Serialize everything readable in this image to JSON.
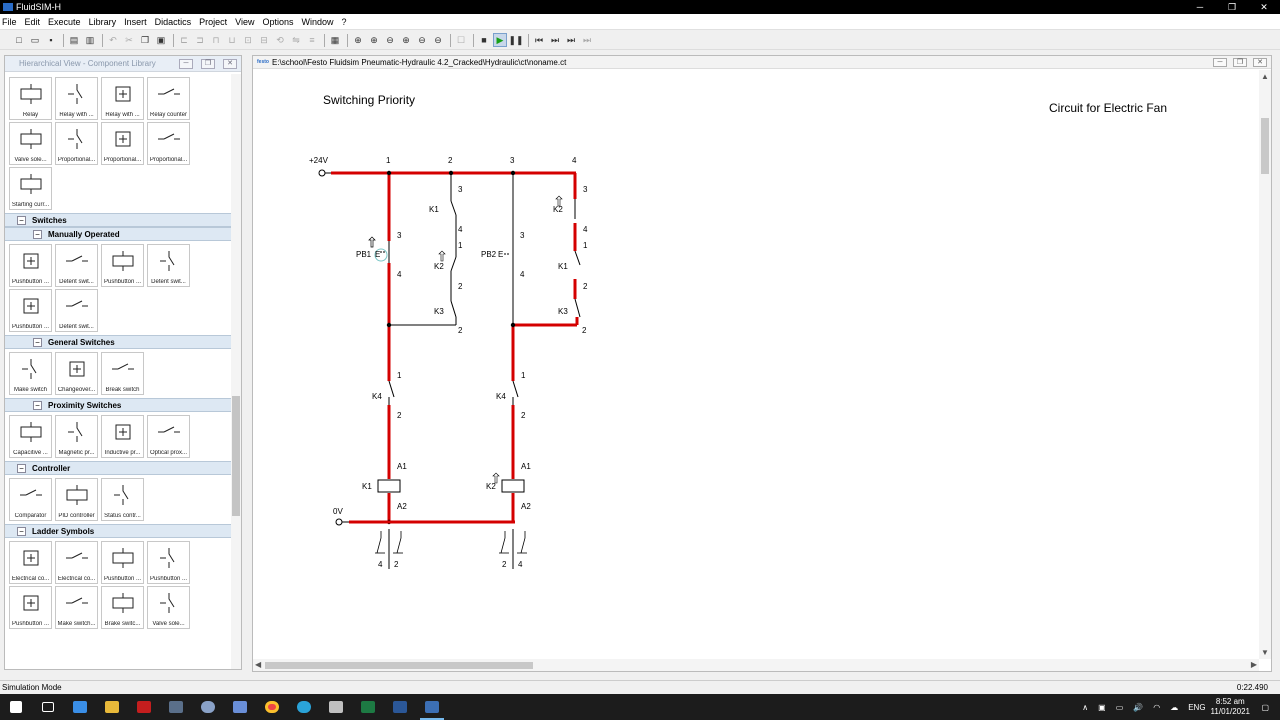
{
  "app": {
    "title": "FluidSIM-H",
    "window_controls": [
      "─",
      "❐",
      "✕"
    ]
  },
  "menu": [
    "File",
    "Edit",
    "Execute",
    "Library",
    "Insert",
    "Didactics",
    "Project",
    "View",
    "Options",
    "Window",
    "?"
  ],
  "left_panel": {
    "title": "Hierarchical View - Component Library",
    "groups": [
      {
        "header": "",
        "indent": 0,
        "tiles": [
          "Relay",
          "Relay with ...",
          "Relay with ...",
          "Relay counter",
          "Valve sole...",
          "Proportional...",
          "Proportional...",
          "Proportional...",
          "Starting curr..."
        ]
      },
      {
        "header": "Switches",
        "indent": 1,
        "tiles": []
      },
      {
        "header": "Manually Operated",
        "indent": 2,
        "tiles": [
          "Pushbutton ...",
          "Detent swit...",
          "Pushbutton ...",
          "Detent swit...",
          "Pushbutton ...",
          "Detent swit..."
        ]
      },
      {
        "header": "General Switches",
        "indent": 2,
        "tiles": [
          "Make switch",
          "Changeover...",
          "Break switch"
        ]
      },
      {
        "header": "Proximity Switches",
        "indent": 2,
        "tiles": [
          "Capacitive ...",
          "Magnetic pr...",
          "Inductive pr...",
          "Optical prox..."
        ]
      },
      {
        "header": "Controller",
        "indent": 1,
        "tiles": [
          "Comparator",
          "PID controller",
          "Status contr..."
        ]
      },
      {
        "header": "Ladder Symbols",
        "indent": 1,
        "tiles": [
          "Electrical co...",
          "Electrical co...",
          "Pushbutton ...",
          "Pushbutton ...",
          "Pushbutton ...",
          "Make switch...",
          "Brake switc...",
          "Valve sole..."
        ]
      }
    ]
  },
  "document": {
    "path": "E:\\school\\Festo Fluidsim Pneumatic-Hydraulic 4.2_Cracked\\Hydraulic\\ct\\noname.ct",
    "logo_text": "festo",
    "title_left": "Switching  Priority",
    "title_right": "Circuit for Electric Fan",
    "labels": {
      "v24": "+24V",
      "v0": "0V",
      "col1": "1",
      "col2": "2",
      "col3": "3",
      "col4": "4",
      "pb1": "PB1",
      "pb2": "PB2",
      "k1": "K1",
      "k2": "K2",
      "k3": "K3",
      "k4": "K4",
      "a1": "A1",
      "a2": "A2",
      "n1": "1",
      "n2": "2",
      "n3": "3",
      "n4": "4",
      "e": "E"
    }
  },
  "status": {
    "mode": "Simulation Mode",
    "time": "0:22.490"
  },
  "tray": {
    "lang": "ENG",
    "time": "8:52 am",
    "date": "11/01/2021"
  },
  "colors": {
    "wire_active": "#d40000",
    "wire_idle": "#000000",
    "accent": "#2a6cc7"
  }
}
